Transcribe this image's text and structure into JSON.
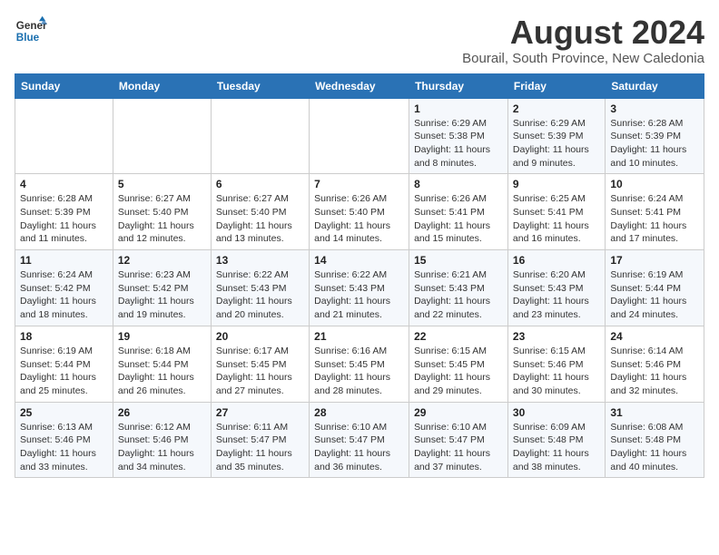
{
  "logo": {
    "line1": "General",
    "line2": "Blue"
  },
  "title": "August 2024",
  "subtitle": "Bourail, South Province, New Caledonia",
  "weekdays": [
    "Sunday",
    "Monday",
    "Tuesday",
    "Wednesday",
    "Thursday",
    "Friday",
    "Saturday"
  ],
  "weeks": [
    [
      {
        "day": "",
        "info": ""
      },
      {
        "day": "",
        "info": ""
      },
      {
        "day": "",
        "info": ""
      },
      {
        "day": "",
        "info": ""
      },
      {
        "day": "1",
        "info": "Sunrise: 6:29 AM\nSunset: 5:38 PM\nDaylight: 11 hours\nand 8 minutes."
      },
      {
        "day": "2",
        "info": "Sunrise: 6:29 AM\nSunset: 5:39 PM\nDaylight: 11 hours\nand 9 minutes."
      },
      {
        "day": "3",
        "info": "Sunrise: 6:28 AM\nSunset: 5:39 PM\nDaylight: 11 hours\nand 10 minutes."
      }
    ],
    [
      {
        "day": "4",
        "info": "Sunrise: 6:28 AM\nSunset: 5:39 PM\nDaylight: 11 hours\nand 11 minutes."
      },
      {
        "day": "5",
        "info": "Sunrise: 6:27 AM\nSunset: 5:40 PM\nDaylight: 11 hours\nand 12 minutes."
      },
      {
        "day": "6",
        "info": "Sunrise: 6:27 AM\nSunset: 5:40 PM\nDaylight: 11 hours\nand 13 minutes."
      },
      {
        "day": "7",
        "info": "Sunrise: 6:26 AM\nSunset: 5:40 PM\nDaylight: 11 hours\nand 14 minutes."
      },
      {
        "day": "8",
        "info": "Sunrise: 6:26 AM\nSunset: 5:41 PM\nDaylight: 11 hours\nand 15 minutes."
      },
      {
        "day": "9",
        "info": "Sunrise: 6:25 AM\nSunset: 5:41 PM\nDaylight: 11 hours\nand 16 minutes."
      },
      {
        "day": "10",
        "info": "Sunrise: 6:24 AM\nSunset: 5:41 PM\nDaylight: 11 hours\nand 17 minutes."
      }
    ],
    [
      {
        "day": "11",
        "info": "Sunrise: 6:24 AM\nSunset: 5:42 PM\nDaylight: 11 hours\nand 18 minutes."
      },
      {
        "day": "12",
        "info": "Sunrise: 6:23 AM\nSunset: 5:42 PM\nDaylight: 11 hours\nand 19 minutes."
      },
      {
        "day": "13",
        "info": "Sunrise: 6:22 AM\nSunset: 5:43 PM\nDaylight: 11 hours\nand 20 minutes."
      },
      {
        "day": "14",
        "info": "Sunrise: 6:22 AM\nSunset: 5:43 PM\nDaylight: 11 hours\nand 21 minutes."
      },
      {
        "day": "15",
        "info": "Sunrise: 6:21 AM\nSunset: 5:43 PM\nDaylight: 11 hours\nand 22 minutes."
      },
      {
        "day": "16",
        "info": "Sunrise: 6:20 AM\nSunset: 5:43 PM\nDaylight: 11 hours\nand 23 minutes."
      },
      {
        "day": "17",
        "info": "Sunrise: 6:19 AM\nSunset: 5:44 PM\nDaylight: 11 hours\nand 24 minutes."
      }
    ],
    [
      {
        "day": "18",
        "info": "Sunrise: 6:19 AM\nSunset: 5:44 PM\nDaylight: 11 hours\nand 25 minutes."
      },
      {
        "day": "19",
        "info": "Sunrise: 6:18 AM\nSunset: 5:44 PM\nDaylight: 11 hours\nand 26 minutes."
      },
      {
        "day": "20",
        "info": "Sunrise: 6:17 AM\nSunset: 5:45 PM\nDaylight: 11 hours\nand 27 minutes."
      },
      {
        "day": "21",
        "info": "Sunrise: 6:16 AM\nSunset: 5:45 PM\nDaylight: 11 hours\nand 28 minutes."
      },
      {
        "day": "22",
        "info": "Sunrise: 6:15 AM\nSunset: 5:45 PM\nDaylight: 11 hours\nand 29 minutes."
      },
      {
        "day": "23",
        "info": "Sunrise: 6:15 AM\nSunset: 5:46 PM\nDaylight: 11 hours\nand 30 minutes."
      },
      {
        "day": "24",
        "info": "Sunrise: 6:14 AM\nSunset: 5:46 PM\nDaylight: 11 hours\nand 32 minutes."
      }
    ],
    [
      {
        "day": "25",
        "info": "Sunrise: 6:13 AM\nSunset: 5:46 PM\nDaylight: 11 hours\nand 33 minutes."
      },
      {
        "day": "26",
        "info": "Sunrise: 6:12 AM\nSunset: 5:46 PM\nDaylight: 11 hours\nand 34 minutes."
      },
      {
        "day": "27",
        "info": "Sunrise: 6:11 AM\nSunset: 5:47 PM\nDaylight: 11 hours\nand 35 minutes."
      },
      {
        "day": "28",
        "info": "Sunrise: 6:10 AM\nSunset: 5:47 PM\nDaylight: 11 hours\nand 36 minutes."
      },
      {
        "day": "29",
        "info": "Sunrise: 6:10 AM\nSunset: 5:47 PM\nDaylight: 11 hours\nand 37 minutes."
      },
      {
        "day": "30",
        "info": "Sunrise: 6:09 AM\nSunset: 5:48 PM\nDaylight: 11 hours\nand 38 minutes."
      },
      {
        "day": "31",
        "info": "Sunrise: 6:08 AM\nSunset: 5:48 PM\nDaylight: 11 hours\nand 40 minutes."
      }
    ]
  ]
}
